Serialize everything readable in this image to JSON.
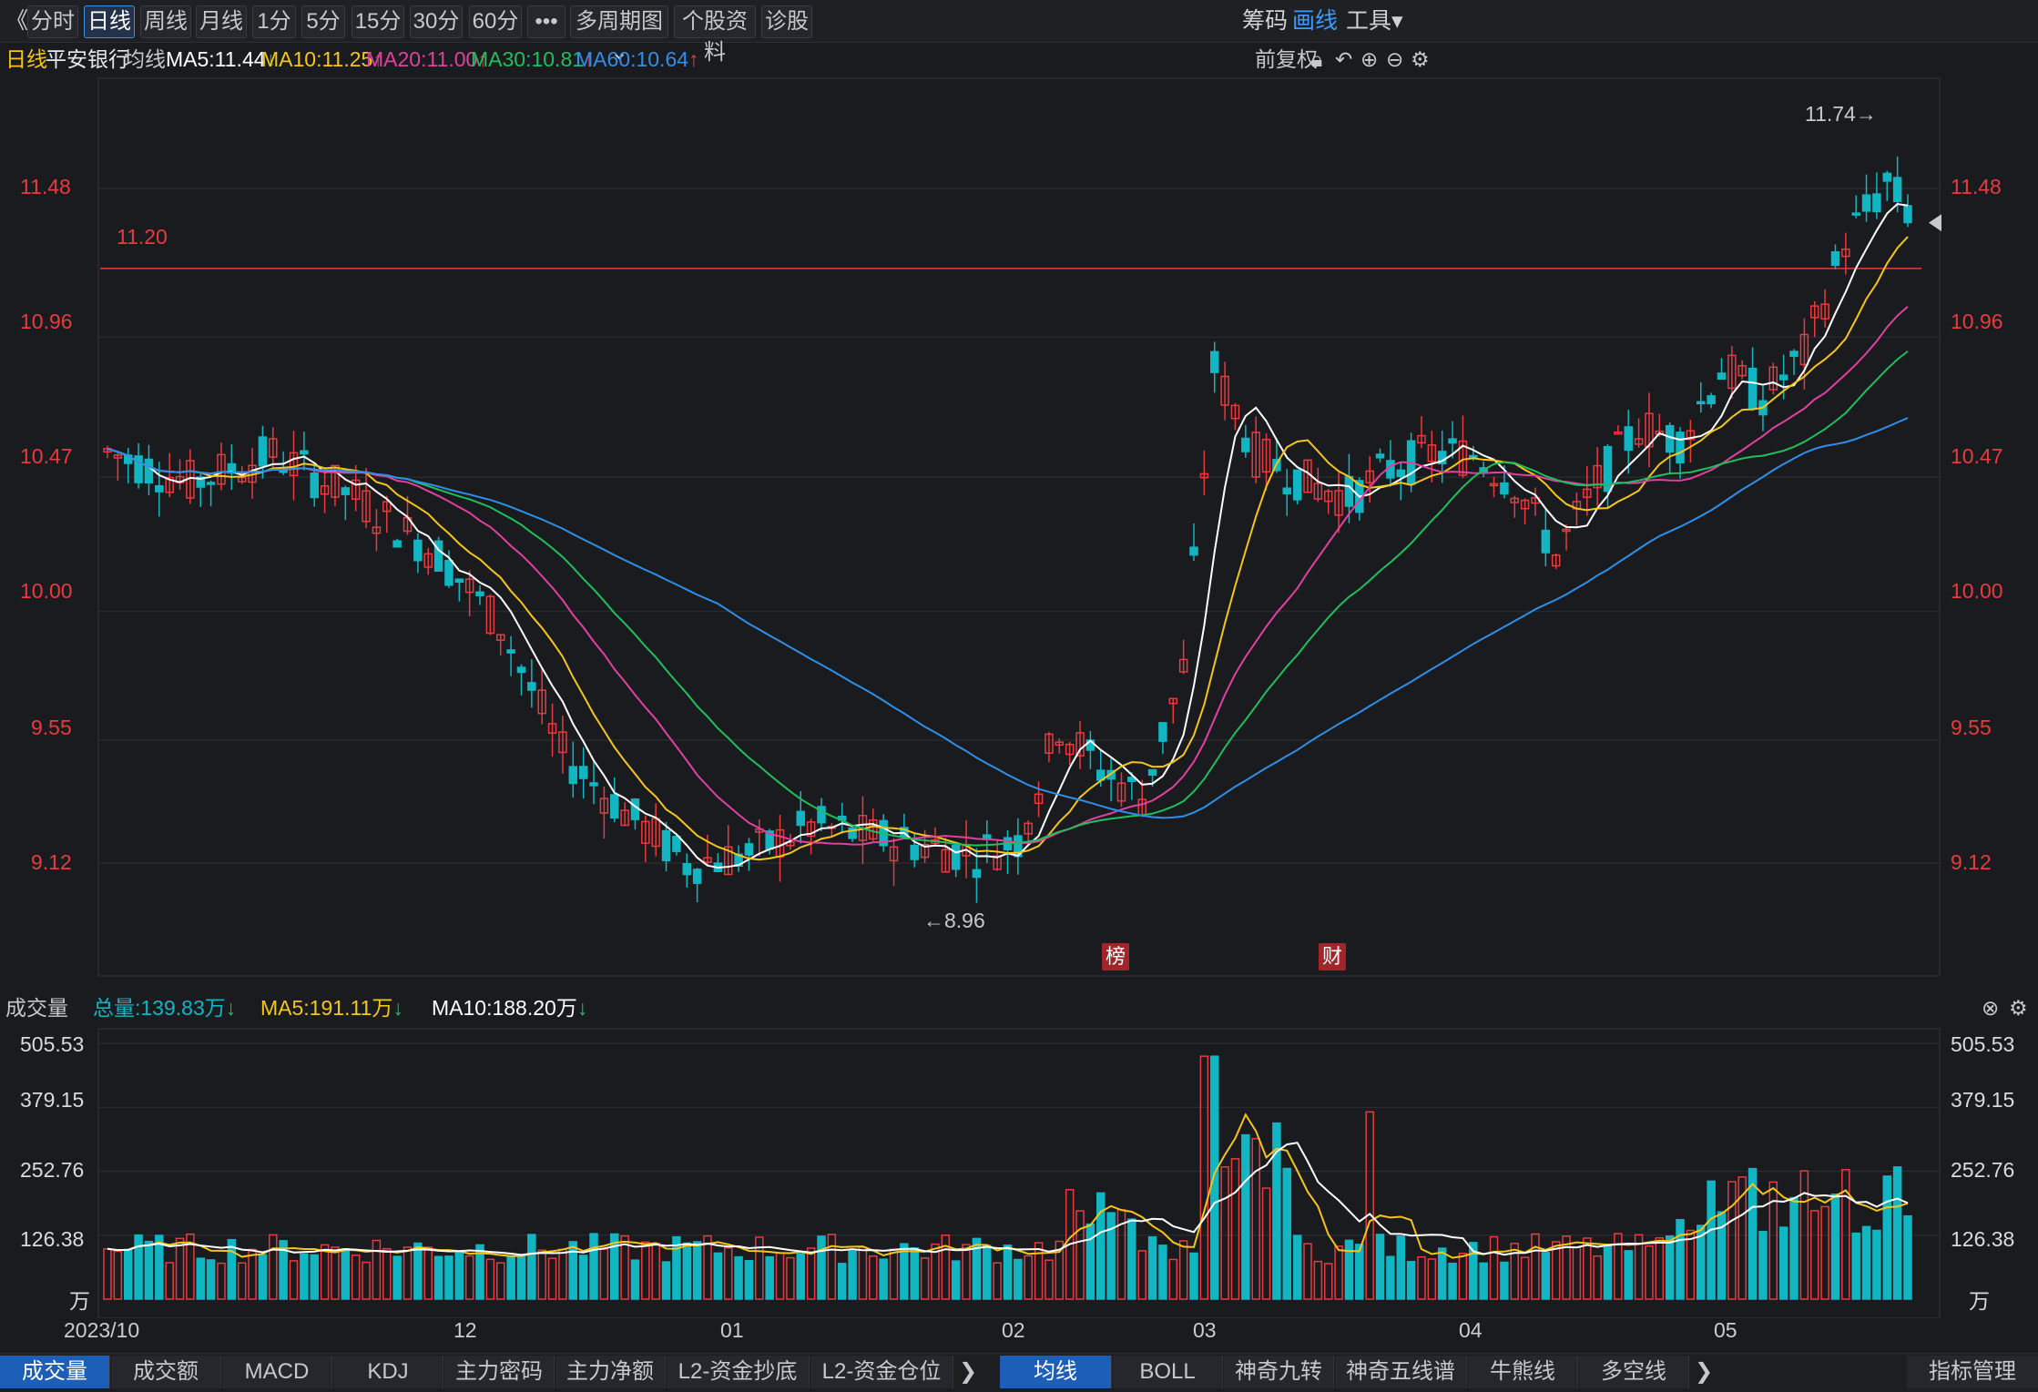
{
  "toolbar": {
    "back_icon": "double-chevron-left",
    "buttons": [
      "分时",
      "日线",
      "周线",
      "月线",
      "1分",
      "5分",
      "15分",
      "30分",
      "60分"
    ],
    "more_label": "•••",
    "multi_period": "多周期图",
    "stock_info": "个股资料",
    "diagnose": "诊股",
    "right_chips": "筹码",
    "right_draw": "画线",
    "right_tools": "工具"
  },
  "info": {
    "period": "日线",
    "name": "平安银行",
    "ma_label": "均线",
    "ma5": "MA5:11.44",
    "ma10": "MA10:11.25",
    "ma20": "MA20:11.00",
    "ma30": "MA30:10.81",
    "ma60": "MA60:10.64",
    "adjust": "前复权"
  },
  "colors": {
    "up": "#e83a3f",
    "down": "#12b5c2",
    "ma5": "#ffffff",
    "ma10": "#f5c518",
    "ma20": "#e040a0",
    "ma30": "#1fbf5c",
    "ma60": "#2f8fe8"
  },
  "price_axis": [
    "11.48",
    "10.96",
    "10.47",
    "10.00",
    "9.55",
    "9.12"
  ],
  "annotations": {
    "high": "11.74→",
    "low": "←8.96",
    "ref_line": "11.20"
  },
  "markers": [
    "榜",
    "财"
  ],
  "volume": {
    "title": "成交量",
    "total": "总量:139.83万",
    "ma5": "MA5:191.11万",
    "ma10": "MA10:188.20万",
    "axis": [
      "505.53",
      "379.15",
      "252.76",
      "126.38"
    ],
    "unit": "万"
  },
  "x_axis": [
    "2023/10",
    "12",
    "01",
    "02",
    "03",
    "04",
    "05"
  ],
  "bottom_tabs_left": [
    "成交量",
    "成交额",
    "MACD",
    "KDJ",
    "主力密码",
    "主力净额",
    "L2-资金抄底",
    "L2-资金仓位"
  ],
  "bottom_tabs_right": [
    "均线",
    "BOLL",
    "神奇九转",
    "神奇五线谱",
    "牛熊线",
    "多空线"
  ],
  "indicator_manage": "指标管理",
  "chart_data": {
    "type": "candlestick",
    "title": "平安银行 日线",
    "yticks": [
      11.48,
      10.96,
      10.47,
      10.0,
      9.55,
      9.12
    ],
    "ylim": [
      8.7,
      11.85
    ],
    "price_high": 11.74,
    "price_low": 8.96,
    "reference_line": 11.2,
    "xticks": [
      "2023/10",
      "12",
      "01",
      "02",
      "03",
      "04",
      "05"
    ],
    "series": [
      {
        "name": "MA5",
        "last": 11.44
      },
      {
        "name": "MA10",
        "last": 11.25
      },
      {
        "name": "MA20",
        "last": 11.0
      },
      {
        "name": "MA30",
        "last": 10.81
      },
      {
        "name": "MA60",
        "last": 10.64
      }
    ],
    "volume_yticks": [
      505.53,
      379.15,
      252.76,
      126.38
    ],
    "volume_total_last": 139.83,
    "volume_ma5_last": 191.11,
    "volume_ma10_last": 188.2
  }
}
